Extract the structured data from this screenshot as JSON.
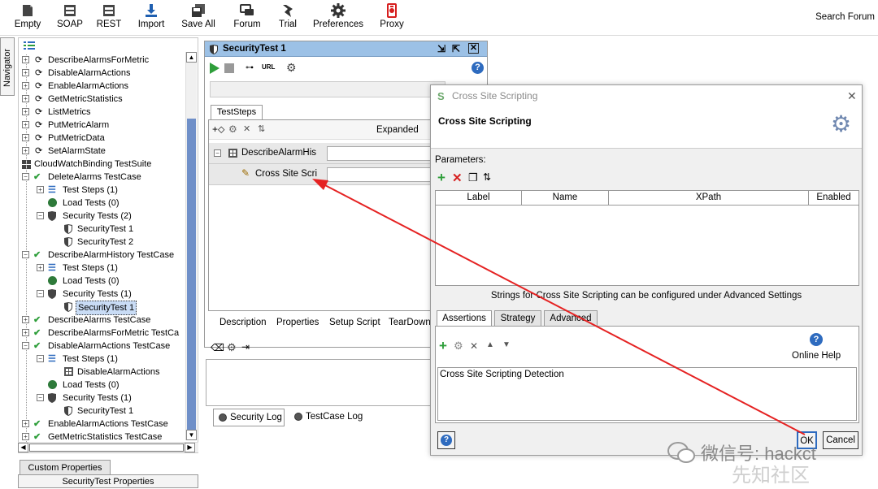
{
  "toolbar": {
    "buttons": [
      {
        "label": "Empty",
        "icon": "empty-project-icon"
      },
      {
        "label": "SOAP",
        "icon": "soap-icon"
      },
      {
        "label": "REST",
        "icon": "rest-icon"
      },
      {
        "label": "Import",
        "icon": "import-icon"
      },
      {
        "label": "Save All",
        "icon": "save-all-icon"
      },
      {
        "label": "Forum",
        "icon": "forum-icon"
      },
      {
        "label": "Trial",
        "icon": "trial-icon"
      },
      {
        "label": "Preferences",
        "icon": "gear-icon"
      },
      {
        "label": "Proxy",
        "icon": "proxy-icon"
      }
    ],
    "search_forum": "Search Forum"
  },
  "navigator": {
    "tab_label": "Navigator",
    "tree": [
      "DescribeAlarmsForMetric",
      "DisableAlarmActions",
      "EnableAlarmActions",
      "GetMetricStatistics",
      "ListMetrics",
      "PutMetricAlarm",
      "PutMetricData",
      "SetAlarmState",
      "CloudWatchBinding TestSuite",
      "DeleteAlarms TestCase",
      "Test Steps (1)",
      "Load Tests (0)",
      "Security Tests (2)",
      "SecurityTest 1",
      "SecurityTest 2",
      "DescribeAlarmHistory TestCase",
      "Test Steps (1)",
      "Load Tests (0)",
      "Security Tests (1)",
      "SecurityTest 1",
      "DescribeAlarms TestCase",
      "DescribeAlarmsForMetric TestCa",
      "DisableAlarmActions TestCase",
      "Test Steps (1)",
      "DisableAlarmActions",
      "Load Tests (0)",
      "Security Tests (1)",
      "SecurityTest 1",
      "EnableAlarmActions TestCase",
      "GetMetricStatistics TestCase"
    ],
    "custom_properties_tab": "Custom Properties",
    "custom_properties_title": "SecurityTest Properties"
  },
  "security_test": {
    "title": "SecurityTest 1",
    "teststeps_tab": "TestSteps",
    "expanded_label": "Expanded",
    "steps": [
      "DescribeAlarmHis",
      "Cross Site Scri"
    ],
    "bottom_tabs": [
      "Description",
      "Properties",
      "Setup Script",
      "TearDown"
    ],
    "log_tabs": [
      "Security Log",
      "TestCase Log"
    ]
  },
  "dialog": {
    "title": "Cross Site Scripting",
    "heading": "Cross Site Scripting",
    "parameters_label": "Parameters:",
    "columns": [
      "Label",
      "Name",
      "XPath",
      "Enabled"
    ],
    "note": "Strings for Cross Site Scripting can be configured under Advanced Settings",
    "tabs": [
      "Assertions",
      "Strategy",
      "Advanced"
    ],
    "online_help": "Online Help",
    "assertions": [
      "Cross Site Scripting Detection"
    ],
    "ok_label": "OK",
    "cancel_label": "Cancel"
  },
  "watermark": {
    "text": "微信号: hackct",
    "subtext": "先知社区"
  },
  "colors": {
    "title_bar_blue": "#9cc1e6",
    "selection_blue": "#c9dcf5",
    "green": "#2e9e3a",
    "red": "#d61f1f",
    "arrow_red": "#e52222"
  }
}
